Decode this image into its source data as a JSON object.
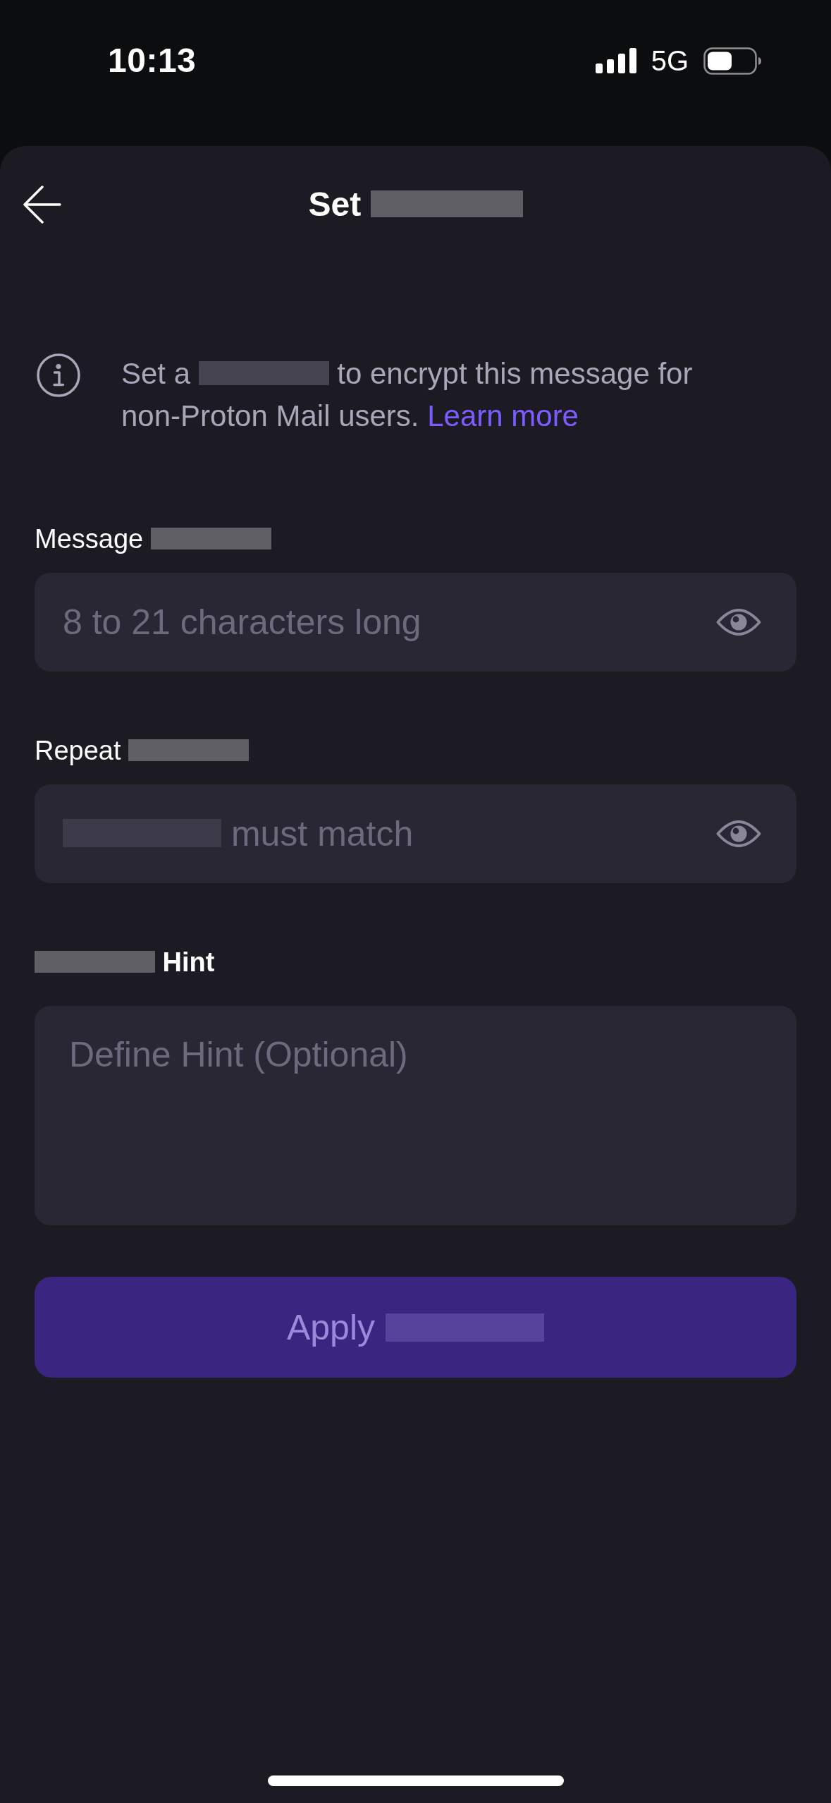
{
  "status_bar": {
    "time": "10:13",
    "network": "5G"
  },
  "header": {
    "title": [
      {
        "kind": "text",
        "text": "Set"
      },
      {
        "kind": "redacted"
      }
    ]
  },
  "info": {
    "text": [
      {
        "kind": "text",
        "text": "Set a"
      },
      {
        "kind": "redacted"
      },
      {
        "kind": "text",
        "text": "to encrypt this message for non-Proton Mail users."
      },
      {
        "kind": "link",
        "text": "Learn more"
      }
    ]
  },
  "fields": [
    {
      "kind": "secret",
      "label_bold": false,
      "label": [
        {
          "kind": "text",
          "text": "Message"
        },
        {
          "kind": "redacted"
        }
      ],
      "placeholder": [
        {
          "kind": "text",
          "text": "8 to 21 characters long"
        }
      ]
    },
    {
      "kind": "secret",
      "label_bold": false,
      "label": [
        {
          "kind": "text",
          "text": "Repeat"
        },
        {
          "kind": "redacted"
        }
      ],
      "placeholder": [
        {
          "kind": "redacted"
        },
        {
          "kind": "text",
          "text": "must match"
        }
      ]
    },
    {
      "kind": "multiline",
      "label_bold": true,
      "label": [
        {
          "kind": "redacted"
        },
        {
          "kind": "text",
          "text": "Hint"
        }
      ],
      "placeholder": [
        {
          "kind": "text",
          "text": "Define Hint (Optional)"
        }
      ]
    }
  ],
  "apply_button": {
    "label": [
      {
        "kind": "text",
        "text": "Apply"
      },
      {
        "kind": "redacted"
      }
    ],
    "disabled": true
  }
}
